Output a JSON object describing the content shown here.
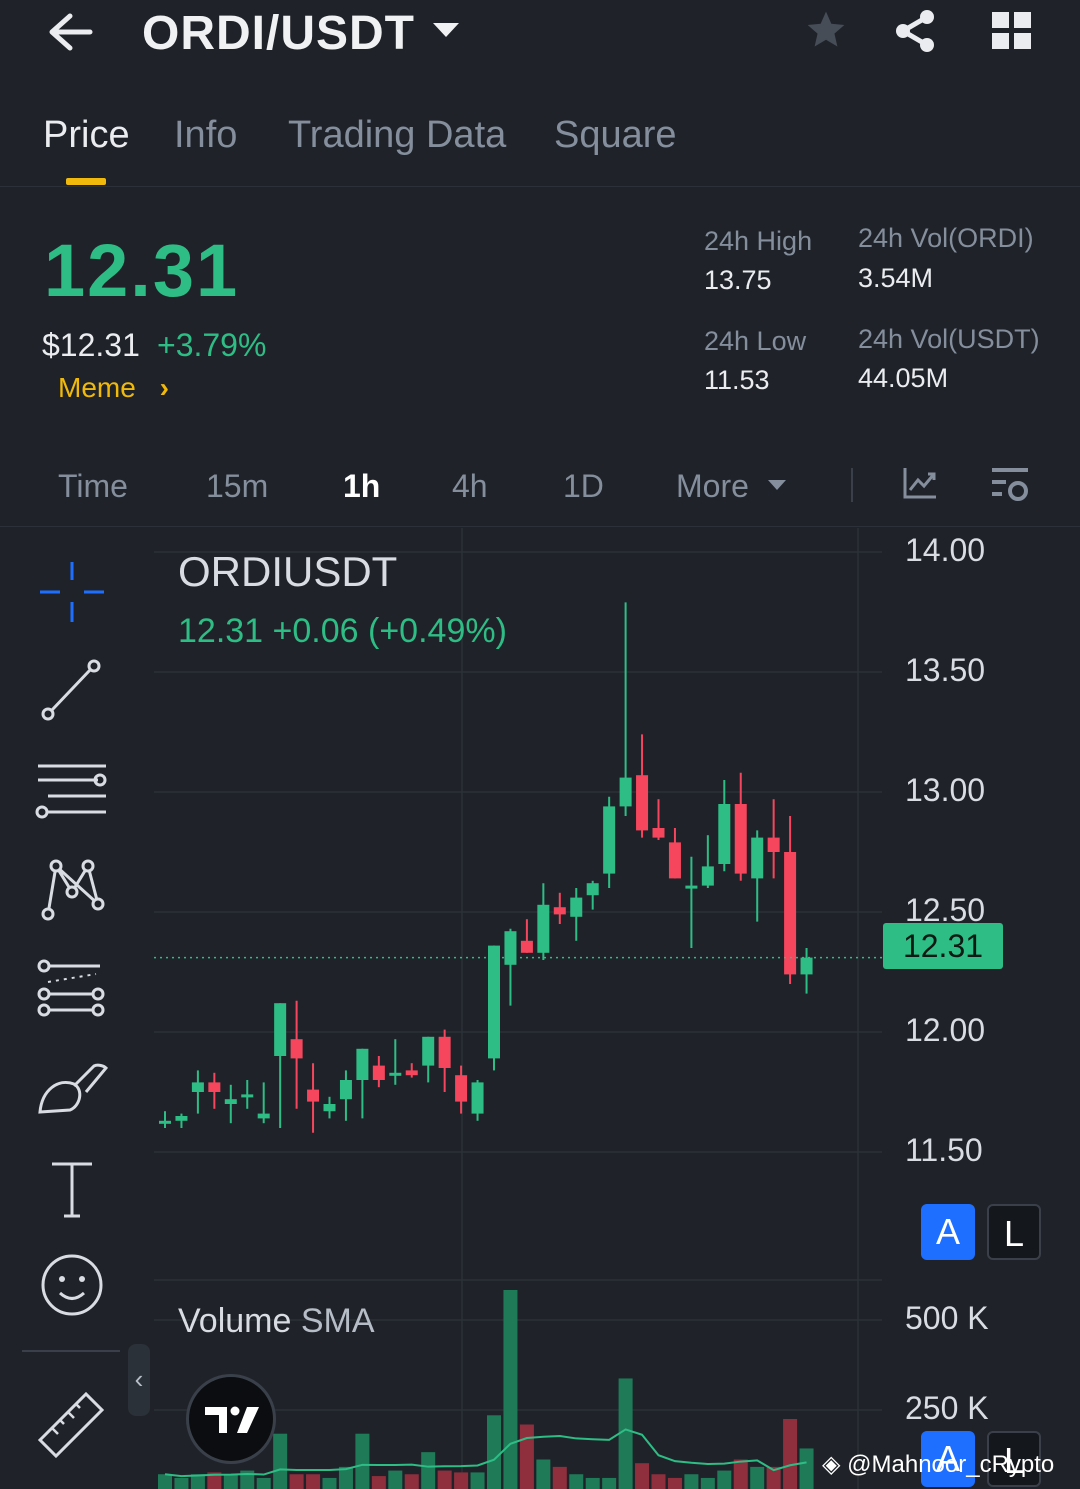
{
  "header": {
    "pair": "ORDI/USDT"
  },
  "tabs": [
    {
      "label": "Price",
      "active": true
    },
    {
      "label": "Info",
      "active": false
    },
    {
      "label": "Trading Data",
      "active": false
    },
    {
      "label": "Square",
      "active": false
    }
  ],
  "ticker": {
    "last_price": "12.31",
    "usd_price": "$12.31",
    "change_pct": "+3.79%",
    "tag": "Meme",
    "high_label": "24h High",
    "high": "13.75",
    "low_label": "24h Low",
    "low": "11.53",
    "vol_base_label": "24h Vol(ORDI)",
    "vol_base": "3.54M",
    "vol_quote_label": "24h Vol(USDT)",
    "vol_quote": "44.05M"
  },
  "timeframes": [
    {
      "label": "Time",
      "active": false
    },
    {
      "label": "15m",
      "active": false
    },
    {
      "label": "1h",
      "active": true
    },
    {
      "label": "4h",
      "active": false
    },
    {
      "label": "1D",
      "active": false
    },
    {
      "label": "More",
      "active": false
    }
  ],
  "chart_overlay": {
    "symbol": "ORDIUSDT",
    "ohlc_line": "12.31  +0.06 (+0.49%)",
    "current_price_badge": "12.31",
    "volume_label": "Volume",
    "volume_sma_label": "SMA",
    "auto_btn": "A",
    "log_btn": "L",
    "watermark": "@Mahnoor_cRypto"
  },
  "colors": {
    "up": "#2ebd85",
    "down": "#f6465d",
    "accent": "#f0b90b",
    "bg": "#1f2329"
  },
  "chart_data": {
    "type": "candlestick",
    "y_ticks": [
      "14.00",
      "13.50",
      "13.00",
      "12.50",
      "12.00",
      "11.50"
    ],
    "ylim": [
      11.0,
      14.05
    ],
    "volume_ticks": [
      "500 K",
      "250 K"
    ],
    "volume_ylim": [
      0,
      540000
    ],
    "candles": [
      {
        "o": 11.62,
        "h": 11.67,
        "l": 11.6,
        "c": 11.63
      },
      {
        "o": 11.63,
        "h": 11.66,
        "l": 11.6,
        "c": 11.65
      },
      {
        "o": 11.75,
        "h": 11.84,
        "l": 11.66,
        "c": 11.79
      },
      {
        "o": 11.79,
        "h": 11.83,
        "l": 11.68,
        "c": 11.75
      },
      {
        "o": 11.7,
        "h": 11.78,
        "l": 11.62,
        "c": 11.72
      },
      {
        "o": 11.73,
        "h": 11.8,
        "l": 11.68,
        "c": 11.74
      },
      {
        "o": 11.64,
        "h": 11.79,
        "l": 11.62,
        "c": 11.66
      },
      {
        "o": 11.9,
        "h": 12.01,
        "l": 11.6,
        "c": 12.12
      },
      {
        "o": 11.97,
        "h": 12.13,
        "l": 11.68,
        "c": 11.89
      },
      {
        "o": 11.76,
        "h": 11.87,
        "l": 11.58,
        "c": 11.71
      },
      {
        "o": 11.67,
        "h": 11.73,
        "l": 11.64,
        "c": 11.7
      },
      {
        "o": 11.72,
        "h": 11.84,
        "l": 11.63,
        "c": 11.8
      },
      {
        "o": 11.8,
        "h": 11.92,
        "l": 11.64,
        "c": 11.93
      },
      {
        "o": 11.86,
        "h": 11.9,
        "l": 11.77,
        "c": 11.8
      },
      {
        "o": 11.83,
        "h": 11.97,
        "l": 11.78,
        "c": 11.83
      },
      {
        "o": 11.84,
        "h": 11.87,
        "l": 11.81,
        "c": 11.82
      },
      {
        "o": 11.86,
        "h": 11.96,
        "l": 11.79,
        "c": 11.98
      },
      {
        "o": 11.98,
        "h": 12.01,
        "l": 11.75,
        "c": 11.85
      },
      {
        "o": 11.82,
        "h": 11.86,
        "l": 11.66,
        "c": 11.71
      },
      {
        "o": 11.66,
        "h": 11.8,
        "l": 11.63,
        "c": 11.79
      },
      {
        "o": 11.89,
        "h": 12.26,
        "l": 11.84,
        "c": 12.36
      },
      {
        "o": 12.28,
        "h": 12.43,
        "l": 12.11,
        "c": 12.42
      },
      {
        "o": 12.38,
        "h": 12.47,
        "l": 12.33,
        "c": 12.33
      },
      {
        "o": 12.33,
        "h": 12.62,
        "l": 12.3,
        "c": 12.53
      },
      {
        "o": 12.52,
        "h": 12.58,
        "l": 12.45,
        "c": 12.49
      },
      {
        "o": 12.48,
        "h": 12.6,
        "l": 12.38,
        "c": 12.56
      },
      {
        "o": 12.57,
        "h": 12.63,
        "l": 12.51,
        "c": 12.62
      },
      {
        "o": 12.66,
        "h": 12.98,
        "l": 12.6,
        "c": 12.94
      },
      {
        "o": 12.94,
        "h": 13.79,
        "l": 12.9,
        "c": 13.06
      },
      {
        "o": 13.07,
        "h": 13.24,
        "l": 12.81,
        "c": 12.84
      },
      {
        "o": 12.85,
        "h": 12.97,
        "l": 12.8,
        "c": 12.81
      },
      {
        "o": 12.79,
        "h": 12.85,
        "l": 12.64,
        "c": 12.64
      },
      {
        "o": 12.61,
        "h": 12.73,
        "l": 12.35,
        "c": 12.61
      },
      {
        "o": 12.61,
        "h": 12.82,
        "l": 12.6,
        "c": 12.69
      },
      {
        "o": 12.7,
        "h": 13.05,
        "l": 12.67,
        "c": 12.95
      },
      {
        "o": 12.95,
        "h": 13.08,
        "l": 12.63,
        "c": 12.66
      },
      {
        "o": 12.64,
        "h": 12.84,
        "l": 12.46,
        "c": 12.81
      },
      {
        "o": 12.81,
        "h": 12.97,
        "l": 12.64,
        "c": 12.75
      },
      {
        "o": 12.75,
        "h": 12.9,
        "l": 12.2,
        "c": 12.24
      },
      {
        "o": 12.24,
        "h": 12.35,
        "l": 12.16,
        "c": 12.31
      }
    ],
    "volumes": [
      40000,
      30000,
      40000,
      45000,
      40000,
      50000,
      30000,
      150000,
      40000,
      40000,
      30000,
      60000,
      150000,
      35000,
      50000,
      40000,
      100000,
      50000,
      45000,
      45000,
      200000,
      540000,
      175000,
      80000,
      60000,
      40000,
      30000,
      30000,
      300000,
      70000,
      40000,
      30000,
      40000,
      30000,
      50000,
      80000,
      60000,
      60000,
      190000,
      110000
    ]
  }
}
